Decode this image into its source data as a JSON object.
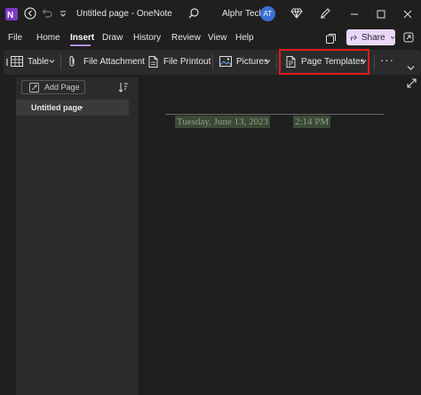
{
  "titlebar": {
    "doc_title": "Untitled page",
    "app_name": "OneNote",
    "separator": "-",
    "account_name": "Alphr Tech",
    "account_initials": "AT"
  },
  "menu": {
    "items": [
      "File",
      "Home",
      "Insert",
      "Draw",
      "History",
      "Review",
      "View",
      "Help"
    ],
    "active": "Insert",
    "share_label": "Share"
  },
  "ribbon": {
    "table_label": "Table",
    "file_attachment_label": "File Attachment",
    "file_printout_label": "File Printout",
    "pictures_label": "Pictures",
    "page_templates_label": "Page Templates",
    "more_label": "···"
  },
  "left_pane": {
    "add_page_label": "Add Page",
    "page_title": "Untitled page",
    "page_dot": "•"
  },
  "canvas": {
    "date": "Tuesday, June 13, 2023",
    "time": "2:14 PM"
  },
  "colors": {
    "accent": "#b48ee0",
    "highlight_box": "#e01b1b",
    "onenote_purple": "#7b3bc4"
  }
}
